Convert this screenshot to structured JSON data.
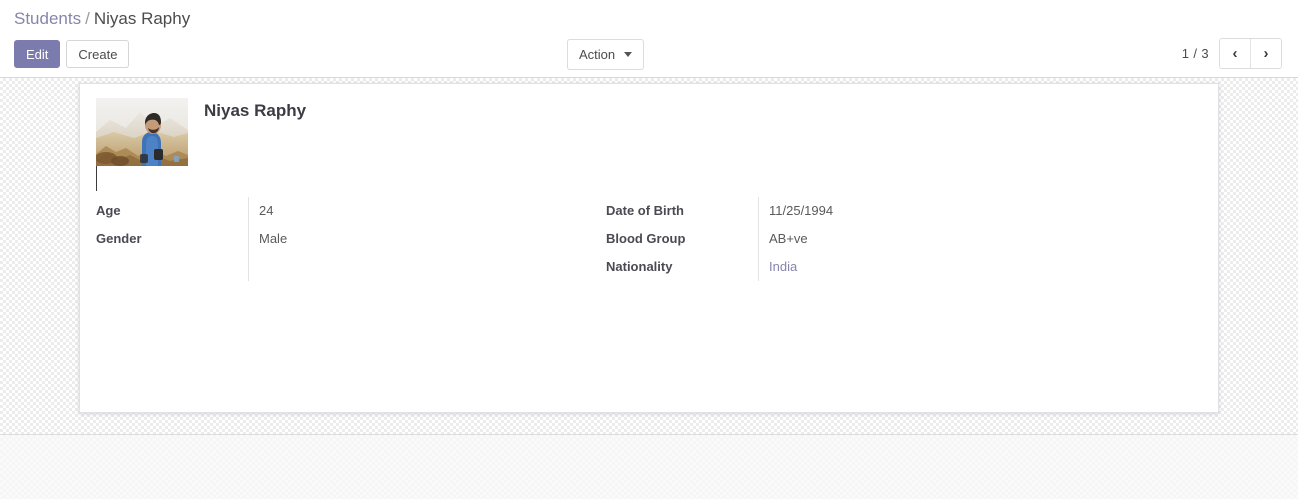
{
  "control_panel": {
    "breadcrumb": {
      "parent": "Students",
      "separator": "/",
      "current": "Niyas Raphy"
    },
    "buttons": {
      "edit": "Edit",
      "create": "Create"
    },
    "action": {
      "label": "Action",
      "caret_icon": "caret-down-icon"
    },
    "pager": {
      "counter": "1 / 3",
      "prev_icon": "chevron-left-icon",
      "next_icon": "chevron-right-icon",
      "prev_glyph": "‹",
      "next_glyph": "›"
    }
  },
  "record": {
    "title": "Niyas Raphy",
    "photo_alt": "student-photo",
    "groups": [
      {
        "name": "left-group",
        "fields": [
          {
            "label": "Age",
            "value": "24",
            "type": "text"
          },
          {
            "label": "Gender",
            "value": "Male",
            "type": "text"
          }
        ]
      },
      {
        "name": "right-group",
        "fields": [
          {
            "label": "Date of Birth",
            "value": "11/25/1994",
            "type": "text"
          },
          {
            "label": "Blood Group",
            "value": "AB+ve",
            "type": "text"
          },
          {
            "label": "Nationality",
            "value": "India",
            "type": "link"
          }
        ]
      }
    ]
  },
  "theme": {
    "primary": "#7c7bad",
    "link": "#8585ad",
    "text": "#4c4c4c",
    "sheet_bg": "#ffffff"
  }
}
